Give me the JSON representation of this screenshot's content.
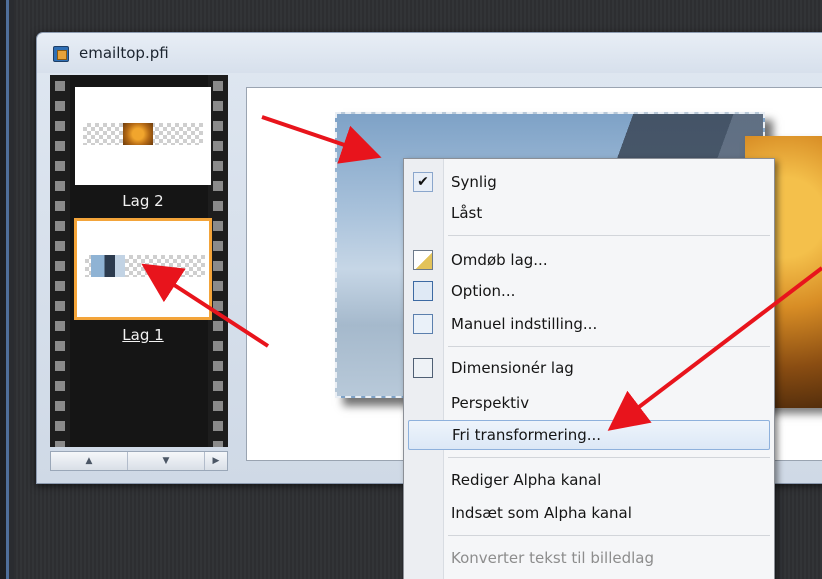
{
  "window": {
    "title": "emailtop.pfi"
  },
  "layers": [
    {
      "label": "Lag 2",
      "selected": false
    },
    {
      "label": "Lag 1",
      "selected": true
    }
  ],
  "panel_scroll": {
    "up": "▲",
    "down": "▼",
    "right": "▶"
  },
  "context_menu": {
    "items": [
      {
        "label": "Synlig",
        "checked": true,
        "icon": "check-icon"
      },
      {
        "label": "Låst",
        "icon": ""
      },
      {
        "label": "Omdøb lag...",
        "icon": "rename-icon"
      },
      {
        "label": "Option...",
        "icon": "option-icon"
      },
      {
        "label": "Manuel indstilling...",
        "icon": "manual-settings-icon"
      },
      {
        "label": "Dimensionér lag",
        "icon": "resize-layer-icon"
      },
      {
        "label": "Perspektiv",
        "icon": ""
      },
      {
        "label": "Fri transformering...",
        "icon": "",
        "highlighted": true
      },
      {
        "label": "Rediger Alpha kanal",
        "icon": ""
      },
      {
        "label": "Indsæt som Alpha kanal",
        "icon": ""
      },
      {
        "label": "Konverter tekst til billedlag",
        "icon": "",
        "disabled": true
      }
    ]
  },
  "colors": {
    "arrow": "#e8141c",
    "selection_border": "#f3a43a",
    "menu_highlight": "#dce8f6"
  }
}
